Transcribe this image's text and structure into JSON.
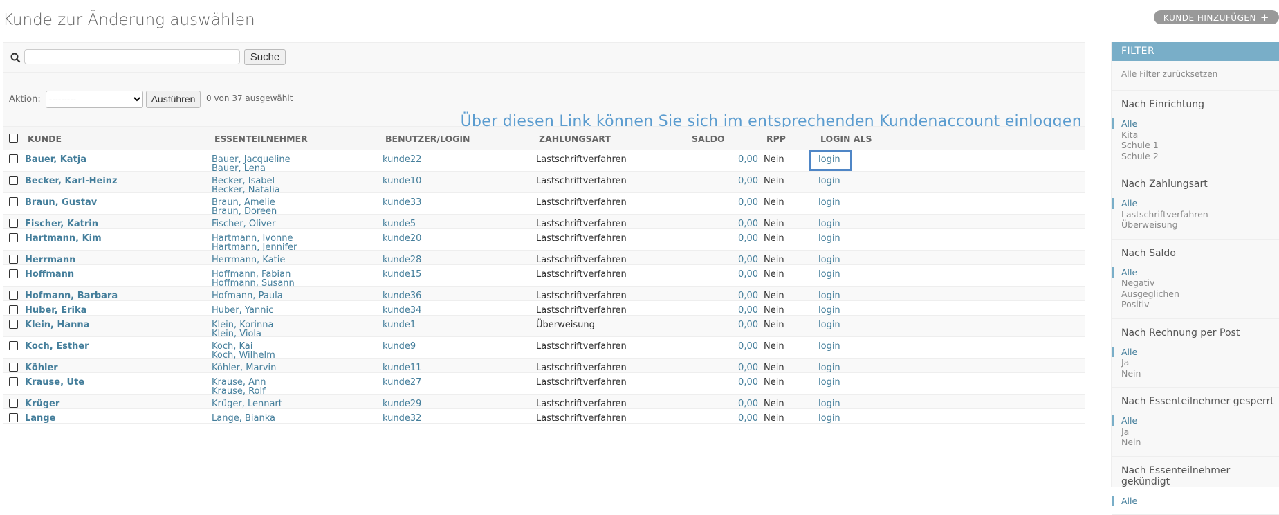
{
  "page": {
    "title": "Kunde zur Änderung auswählen",
    "add_button": "KUNDE HINZUFÜGEN"
  },
  "search": {
    "value": "",
    "placeholder": "",
    "button": "Suche"
  },
  "actions": {
    "label": "Aktion:",
    "selected": "---------",
    "button": "Ausführen",
    "count_text": "0 von 37 ausgewählt"
  },
  "annotation": "Über diesen Link können Sie sich im entsprechenden Kundenaccount einloggen",
  "table": {
    "headers": {
      "kunde": "KUNDE",
      "esse": "ESSENTEILNEHMER",
      "login": "BENUTZER/LOGIN",
      "zahl": "ZAHLUNGSART",
      "saldo": "SALDO",
      "rpp": "RPP",
      "las": "LOGIN ALS"
    },
    "rows": [
      {
        "kunde": "Bauer, Katja",
        "esse": [
          "Bauer, Jacqueline",
          "Bauer, Lena"
        ],
        "login": "kunde22",
        "zahl": "Lastschriftverfahren",
        "saldo": "0,00",
        "rpp": "Nein",
        "las": "login"
      },
      {
        "kunde": "Becker, Karl-Heinz",
        "esse": [
          "Becker, Isabel",
          "Becker, Natalia"
        ],
        "login": "kunde10",
        "zahl": "Lastschriftverfahren",
        "saldo": "0,00",
        "rpp": "Nein",
        "las": "login"
      },
      {
        "kunde": "Braun, Gustav",
        "esse": [
          "Braun, Amelie",
          "Braun, Doreen"
        ],
        "login": "kunde33",
        "zahl": "Lastschriftverfahren",
        "saldo": "0,00",
        "rpp": "Nein",
        "las": "login"
      },
      {
        "kunde": "Fischer, Katrin",
        "esse": [
          "Fischer, Oliver"
        ],
        "login": "kunde5",
        "zahl": "Lastschriftverfahren",
        "saldo": "0,00",
        "rpp": "Nein",
        "las": "login"
      },
      {
        "kunde": "Hartmann, Kim",
        "esse": [
          "Hartmann, Ivonne",
          "Hartmann, Jennifer"
        ],
        "login": "kunde20",
        "zahl": "Lastschriftverfahren",
        "saldo": "0,00",
        "rpp": "Nein",
        "las": "login"
      },
      {
        "kunde": "Herrmann",
        "esse": [
          "Herrmann, Katie"
        ],
        "login": "kunde28",
        "zahl": "Lastschriftverfahren",
        "saldo": "0,00",
        "rpp": "Nein",
        "las": "login"
      },
      {
        "kunde": "Hoffmann",
        "esse": [
          "Hoffmann, Fabian",
          "Hoffmann, Susann"
        ],
        "login": "kunde15",
        "zahl": "Lastschriftverfahren",
        "saldo": "0,00",
        "rpp": "Nein",
        "las": "login"
      },
      {
        "kunde": "Hofmann, Barbara",
        "esse": [
          "Hofmann, Paula"
        ],
        "login": "kunde36",
        "zahl": "Lastschriftverfahren",
        "saldo": "0,00",
        "rpp": "Nein",
        "las": "login"
      },
      {
        "kunde": "Huber, Erika",
        "esse": [
          "Huber, Yannic"
        ],
        "login": "kunde34",
        "zahl": "Lastschriftverfahren",
        "saldo": "0,00",
        "rpp": "Nein",
        "las": "login"
      },
      {
        "kunde": "Klein, Hanna",
        "esse": [
          "Klein, Korinna",
          "Klein, Viola"
        ],
        "login": "kunde1",
        "zahl": "Überweisung",
        "saldo": "0,00",
        "rpp": "Nein",
        "las": "login"
      },
      {
        "kunde": "Koch, Esther",
        "esse": [
          "Koch, Kai",
          "Koch, Wilhelm"
        ],
        "login": "kunde9",
        "zahl": "Lastschriftverfahren",
        "saldo": "0,00",
        "rpp": "Nein",
        "las": "login"
      },
      {
        "kunde": "Köhler",
        "esse": [
          "Köhler, Marvin"
        ],
        "login": "kunde11",
        "zahl": "Lastschriftverfahren",
        "saldo": "0,00",
        "rpp": "Nein",
        "las": "login"
      },
      {
        "kunde": "Krause, Ute",
        "esse": [
          "Krause, Ann",
          "Krause, Rolf"
        ],
        "login": "kunde27",
        "zahl": "Lastschriftverfahren",
        "saldo": "0,00",
        "rpp": "Nein",
        "las": "login"
      },
      {
        "kunde": "Krüger",
        "esse": [
          "Krüger, Lennart"
        ],
        "login": "kunde29",
        "zahl": "Lastschriftverfahren",
        "saldo": "0,00",
        "rpp": "Nein",
        "las": "login"
      },
      {
        "kunde": "Lange",
        "esse": [
          "Lange, Bianka"
        ],
        "login": "kunde32",
        "zahl": "Lastschriftverfahren",
        "saldo": "0,00",
        "rpp": "Nein",
        "las": "login"
      }
    ]
  },
  "filter": {
    "title": "FILTER",
    "reset": "Alle Filter zurücksetzen",
    "groups": [
      {
        "title": "Nach Einrichtung",
        "options": [
          "Alle",
          "Kita",
          "Schule 1",
          "Schule 2"
        ]
      },
      {
        "title": "Nach Zahlungsart",
        "options": [
          "Alle",
          "Lastschriftverfahren",
          "Überweisung"
        ]
      },
      {
        "title": "Nach Saldo",
        "options": [
          "Alle",
          "Negativ",
          "Ausgeglichen",
          "Positiv"
        ]
      },
      {
        "title": "Nach Rechnung per Post",
        "options": [
          "Alle",
          "Ja",
          "Nein"
        ]
      },
      {
        "title": "Nach Essenteilnehmer gesperrt",
        "options": [
          "Alle",
          "Ja",
          "Nein"
        ]
      },
      {
        "title": "Nach Essenteilnehmer gekündigt",
        "options": [
          "Alle"
        ]
      }
    ]
  },
  "colors": {
    "link": "#447e9b",
    "filter_header": "#79aec8",
    "highlight": "#4f86c6",
    "annotation": "#5b9ccf"
  }
}
